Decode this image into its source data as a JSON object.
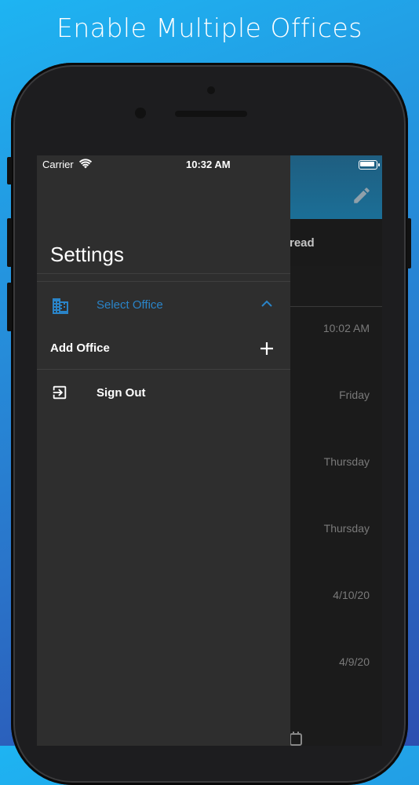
{
  "headline": "Enable Multiple Offices",
  "status_bar": {
    "carrier": "Carrier",
    "time": "10:32 AM"
  },
  "drawer": {
    "title": "Settings",
    "items": [
      {
        "label": "Select Office",
        "icon": "office-building-icon",
        "trailing_icon": "chevron-up-icon",
        "color": "#2a84c8"
      },
      {
        "label": "Add Office",
        "trailing_icon": "plus-icon"
      },
      {
        "label": "Sign Out",
        "icon": "sign-out-icon"
      }
    ]
  },
  "background_app": {
    "tab_partial": "read",
    "message_times": [
      "10:02 AM",
      "Friday",
      "Thursday",
      "Thursday",
      "4/10/20",
      "4/9/20"
    ]
  },
  "colors": {
    "accent": "#2a84c8",
    "drawer_bg": "#2e2e2e",
    "header_bg": "#1b6f97"
  }
}
